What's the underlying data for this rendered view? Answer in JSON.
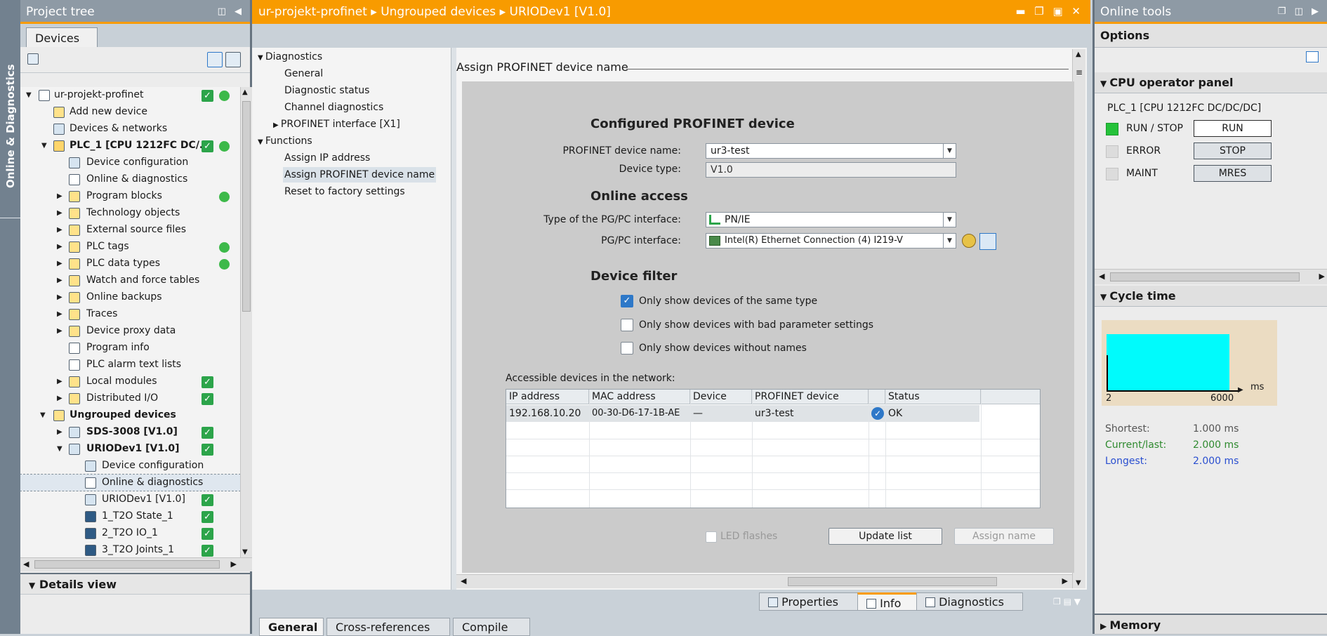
{
  "sidebar_strip": {
    "label": "Online & Diagnostics"
  },
  "project_tree": {
    "title": "Project tree",
    "tab": "Devices",
    "items": [
      {
        "label": "ur-projekt-profinet",
        "bold": false,
        "status": "check-dot"
      },
      {
        "label": "Add new device"
      },
      {
        "label": "Devices & networks"
      },
      {
        "label": "PLC_1 [CPU 1212FC DC/...",
        "bold": true,
        "status": "check-dot"
      },
      {
        "label": "Device configuration"
      },
      {
        "label": "Online & diagnostics"
      },
      {
        "label": "Program blocks",
        "status": "dot"
      },
      {
        "label": "Technology objects"
      },
      {
        "label": "External source files"
      },
      {
        "label": "PLC tags",
        "status": "dot"
      },
      {
        "label": "PLC data types",
        "status": "dot"
      },
      {
        "label": "Watch and force tables"
      },
      {
        "label": "Online backups"
      },
      {
        "label": "Traces"
      },
      {
        "label": "Device proxy data"
      },
      {
        "label": "Program info"
      },
      {
        "label": "PLC alarm text lists"
      },
      {
        "label": "Local modules",
        "status": "check"
      },
      {
        "label": "Distributed I/O",
        "status": "check"
      },
      {
        "label": "Ungrouped devices",
        "bold": true
      },
      {
        "label": "SDS-3008 [V1.0]",
        "bold": true,
        "status": "check"
      },
      {
        "label": "URIODev1 [V1.0]",
        "bold": true,
        "status": "check"
      },
      {
        "label": "Device configuration"
      },
      {
        "label": "Online & diagnostics",
        "selected": true
      },
      {
        "label": "URIODev1 [V1.0]",
        "status": "check"
      },
      {
        "label": "1_T2O State_1",
        "status": "check"
      },
      {
        "label": "2_T2O IO_1",
        "status": "check"
      },
      {
        "label": "3_T2O Joints_1",
        "status": "check"
      }
    ],
    "details_view": "Details view"
  },
  "editor": {
    "breadcrumb": [
      "ur-projekt-profinet",
      "Ungrouped devices",
      "URIODev1 [V1.0]"
    ],
    "nav": {
      "diagnostics": "Diagnostics",
      "general": "General",
      "diagnostic_status": "Diagnostic status",
      "channel_diagnostics": "Channel diagnostics",
      "profinet_interface": "PROFINET interface [X1]",
      "functions": "Functions",
      "assign_ip": "Assign IP address",
      "assign_name": "Assign PROFINET device name",
      "reset": "Reset to factory settings"
    },
    "page_title": "Assign PROFINET device name",
    "configured": {
      "heading": "Configured PROFINET device",
      "name_label": "PROFINET device name:",
      "name_value": "ur3-test",
      "type_label": "Device type:",
      "type_value": "V1.0"
    },
    "online_access": {
      "heading": "Online access",
      "iftype_label": "Type of the PG/PC interface:",
      "iftype_value": "PN/IE",
      "if_label": "PG/PC interface:",
      "if_value": "Intel(R) Ethernet Connection (4) I219-V"
    },
    "device_filter": {
      "heading": "Device filter",
      "opt1": "Only show devices of the same type",
      "opt2": "Only show devices with bad parameter settings",
      "opt3": "Only show devices without names"
    },
    "table": {
      "caption": "Accessible devices in the network:",
      "columns": [
        "IP address",
        "MAC address",
        "Device",
        "PROFINET device name",
        "Status"
      ],
      "row": {
        "ip": "192.168.10.20",
        "mac": "00-30-D6-17-1B-AE",
        "device": "—",
        "name": "ur3-test",
        "status": "OK"
      }
    },
    "led_flashes": "LED flashes",
    "update_list": "Update list",
    "assign_name_btn": "Assign name",
    "inspector_tabs": {
      "properties": "Properties",
      "info": "Info",
      "diagnostics": "Diagnostics"
    },
    "bottom_tabs": [
      "General",
      "Cross-references",
      "Compile"
    ]
  },
  "online_tools": {
    "title": "Online tools",
    "options": "Options",
    "cpu_panel": {
      "heading": "CPU operator panel",
      "device": "PLC_1 [CPU 1212FC DC/DC/DC]",
      "run_stop": "RUN / STOP",
      "error": "ERROR",
      "maint": "MAINT",
      "btn_run": "RUN",
      "btn_stop": "STOP",
      "btn_mres": "MRES"
    },
    "cycle_time": {
      "heading": "Cycle time",
      "axis_min": "2",
      "axis_max": "6000",
      "unit": "ms",
      "shortest_label": "Shortest:",
      "shortest": "1.000 ms",
      "current_label": "Current/last:",
      "current": "2.000 ms",
      "longest_label": "Longest:",
      "longest": "2.000 ms"
    },
    "memory": "Memory"
  }
}
